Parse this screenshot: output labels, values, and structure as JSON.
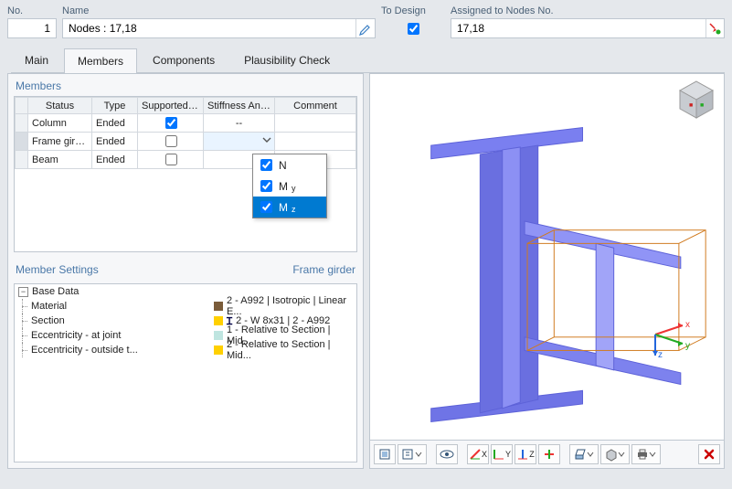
{
  "top": {
    "no_label": "No.",
    "no_value": "1",
    "name_label": "Name",
    "name_value": "Nodes : 17,18",
    "to_design_label": "To Design",
    "to_design_checked": true,
    "assigned_label": "Assigned to Nodes No.",
    "assigned_value": "17,18"
  },
  "tabs": {
    "items": [
      "Main",
      "Members",
      "Components",
      "Plausibility Check"
    ],
    "active": 1
  },
  "members": {
    "title": "Members",
    "columns": [
      "Status",
      "Type",
      "Supported En",
      "Stiffness Analy",
      "Comment"
    ],
    "rows": [
      {
        "status": "Column",
        "type": "Ended",
        "supported": true,
        "stiffness": "--"
      },
      {
        "status": "Frame girder",
        "type": "Ended",
        "supported": false,
        "stiffness": ""
      },
      {
        "status": "Beam",
        "type": "Ended",
        "supported": false,
        "stiffness": ""
      }
    ],
    "dropdown": {
      "open_on_row": 1,
      "options": [
        {
          "label_main": "N",
          "label_sub": "",
          "checked": true,
          "selected": false
        },
        {
          "label_main": "M",
          "label_sub": "y",
          "checked": true,
          "selected": false
        },
        {
          "label_main": "M",
          "label_sub": "z",
          "checked": true,
          "selected": true
        }
      ]
    }
  },
  "member_settings": {
    "title": "Member Settings",
    "context": "Frame girder",
    "group": "Base Data",
    "rows": [
      {
        "label": "Material",
        "swatch": "#7a5c3a",
        "icon": "",
        "text": "2 - A992 | Isotropic | Linear E..."
      },
      {
        "label": "Section",
        "swatch": "#ffd000",
        "icon": "Ɪ",
        "text": "2 - W 8x31 | 2 - A992"
      },
      {
        "label": "Eccentricity - at joint",
        "swatch": "#bfe5e0",
        "icon": "",
        "text": "1 - Relative to Section | Mid..."
      },
      {
        "label": "Eccentricity - outside t...",
        "swatch": "#ffd000",
        "icon": "",
        "text": "2 - Relative to Section | Mid..."
      }
    ]
  },
  "toolbar": {
    "buttons": [
      {
        "name": "view-preset-icon"
      },
      {
        "name": "view-preset-dropdown-icon"
      },
      {
        "name": "show-model-icon"
      },
      {
        "name": "axis-x-icon",
        "label": "X"
      },
      {
        "name": "axis-y-icon",
        "label": "Y"
      },
      {
        "name": "axis-z-icon",
        "label": "Z"
      },
      {
        "name": "fit-view-icon"
      },
      {
        "name": "projection-dropdown-icon"
      },
      {
        "name": "render-style-dropdown-icon"
      },
      {
        "name": "print-dropdown-icon"
      },
      {
        "name": "delete-icon"
      }
    ]
  },
  "colors": {
    "member": "#7a7ff0",
    "member_dark": "#5d62d8",
    "edge": "#d07a1e",
    "axis_x": "#e33",
    "axis_y": "#2a2",
    "axis_z": "#26d"
  }
}
